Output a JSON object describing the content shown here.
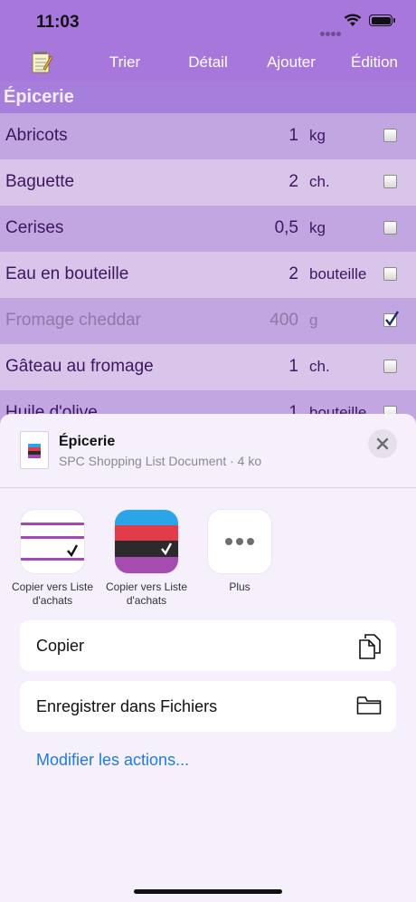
{
  "status": {
    "time": "11:03"
  },
  "toolbar": {
    "sort": "Trier",
    "detail": "Détail",
    "add": "Ajouter",
    "edit": "Édition"
  },
  "list": {
    "section": "Épicerie",
    "items": [
      {
        "name": "Abricots",
        "qty": "1",
        "unit": "kg",
        "checked": false
      },
      {
        "name": "Baguette",
        "qty": "2",
        "unit": "ch.",
        "checked": false
      },
      {
        "name": "Cerises",
        "qty": "0,5",
        "unit": "kg",
        "checked": false
      },
      {
        "name": "Eau en bouteille",
        "qty": "2",
        "unit": "bouteille",
        "checked": false
      },
      {
        "name": "Fromage cheddar",
        "qty": "400",
        "unit": "g",
        "checked": true
      },
      {
        "name": "Gâteau au fromage",
        "qty": "1",
        "unit": "ch.",
        "checked": false
      },
      {
        "name": "Huile d'olive",
        "qty": "1",
        "unit": "bouteille",
        "checked": false
      }
    ]
  },
  "share": {
    "title": "Épicerie",
    "subtitle": "SPC Shopping List Document · 4 ko",
    "apps": [
      {
        "label": "Copier vers Liste d'achats"
      },
      {
        "label": "Copier vers Liste d'achats"
      },
      {
        "label": "Plus"
      }
    ],
    "actions": {
      "copy": "Copier",
      "save": "Enregistrer dans Fichiers"
    },
    "edit_actions": "Modifier les actions..."
  },
  "colors": {
    "accent": "#1d7ce0",
    "toolbar": "#a777dc",
    "row_dark": "#c2a6e2",
    "row_light": "#d9c5ea",
    "sheet": "#f6effc"
  }
}
